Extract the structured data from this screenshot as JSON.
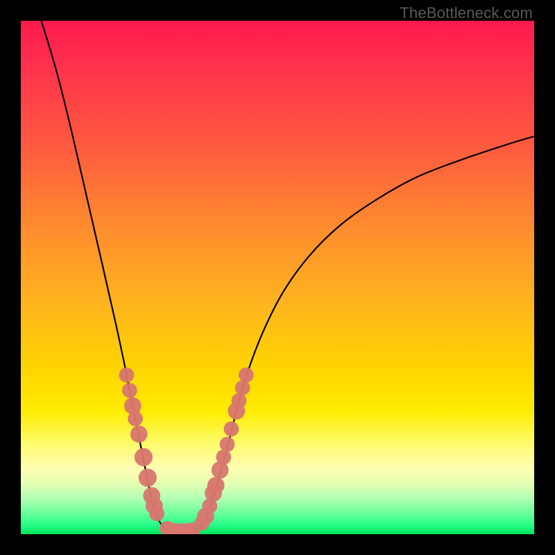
{
  "watermark_text": "TheBottleneck.com",
  "chart_data": {
    "type": "line",
    "title": "",
    "xlabel": "",
    "ylabel": "",
    "xlim": [
      0,
      100
    ],
    "ylim": [
      0,
      100
    ],
    "grid": false,
    "legend": false,
    "curve_left": [
      {
        "x": 4,
        "y": 100
      },
      {
        "x": 7,
        "y": 90
      },
      {
        "x": 10,
        "y": 78
      },
      {
        "x": 13,
        "y": 65
      },
      {
        "x": 16,
        "y": 52
      },
      {
        "x": 18.5,
        "y": 41
      },
      {
        "x": 20,
        "y": 34
      },
      {
        "x": 21,
        "y": 29
      },
      {
        "x": 22,
        "y": 24
      },
      {
        "x": 23,
        "y": 19
      },
      {
        "x": 24,
        "y": 14
      },
      {
        "x": 25,
        "y": 9
      },
      {
        "x": 26,
        "y": 5
      },
      {
        "x": 27,
        "y": 2.5
      },
      {
        "x": 28,
        "y": 1.3
      },
      {
        "x": 29,
        "y": 0.7
      }
    ],
    "curve_flat": [
      {
        "x": 29,
        "y": 0.7
      },
      {
        "x": 30,
        "y": 0.6
      },
      {
        "x": 31,
        "y": 0.6
      },
      {
        "x": 32,
        "y": 0.6
      },
      {
        "x": 33,
        "y": 0.7
      },
      {
        "x": 34,
        "y": 0.9
      }
    ],
    "curve_right": [
      {
        "x": 34,
        "y": 0.9
      },
      {
        "x": 35,
        "y": 1.5
      },
      {
        "x": 36,
        "y": 3
      },
      {
        "x": 37,
        "y": 5.5
      },
      {
        "x": 38,
        "y": 9
      },
      {
        "x": 40,
        "y": 16
      },
      {
        "x": 42,
        "y": 24
      },
      {
        "x": 44,
        "y": 31
      },
      {
        "x": 47,
        "y": 39
      },
      {
        "x": 51,
        "y": 47
      },
      {
        "x": 56,
        "y": 54
      },
      {
        "x": 62,
        "y": 60
      },
      {
        "x": 69,
        "y": 65
      },
      {
        "x": 77,
        "y": 69.5
      },
      {
        "x": 86,
        "y": 73
      },
      {
        "x": 95,
        "y": 76
      },
      {
        "x": 100,
        "y": 77.5
      }
    ],
    "markers_left": [
      {
        "x": 20.6,
        "y": 31,
        "r": 1.0
      },
      {
        "x": 21.2,
        "y": 28,
        "r": 1.0
      },
      {
        "x": 21.8,
        "y": 25,
        "r": 1.2
      },
      {
        "x": 22.3,
        "y": 22.5,
        "r": 1.0
      },
      {
        "x": 23.0,
        "y": 19.5,
        "r": 1.2
      },
      {
        "x": 23.9,
        "y": 15,
        "r": 1.3
      },
      {
        "x": 24.7,
        "y": 11,
        "r": 1.3
      },
      {
        "x": 25.5,
        "y": 7.5,
        "r": 1.2
      },
      {
        "x": 26.0,
        "y": 5.5,
        "r": 1.2
      },
      {
        "x": 26.5,
        "y": 4.0,
        "r": 1.0
      }
    ],
    "markers_bottom": [
      {
        "x": 28.5,
        "y": 1.1,
        "r": 1.0
      },
      {
        "x": 29.5,
        "y": 0.8,
        "r": 1.0
      },
      {
        "x": 30.5,
        "y": 0.65,
        "r": 1.0
      },
      {
        "x": 31.5,
        "y": 0.65,
        "r": 1.0
      },
      {
        "x": 32.5,
        "y": 0.7,
        "r": 1.0
      },
      {
        "x": 33.5,
        "y": 0.85,
        "r": 1.0
      }
    ],
    "markers_right": [
      {
        "x": 35.3,
        "y": 2.2,
        "r": 1.0
      },
      {
        "x": 36.0,
        "y": 3.5,
        "r": 1.2
      },
      {
        "x": 36.8,
        "y": 5.5,
        "r": 1.0
      },
      {
        "x": 37.5,
        "y": 8.0,
        "r": 1.2
      },
      {
        "x": 38.0,
        "y": 9.5,
        "r": 1.2
      },
      {
        "x": 38.8,
        "y": 12.5,
        "r": 1.2
      },
      {
        "x": 39.5,
        "y": 15,
        "r": 1.0
      },
      {
        "x": 40.2,
        "y": 17.5,
        "r": 1.0
      },
      {
        "x": 41.0,
        "y": 20.5,
        "r": 1.0
      },
      {
        "x": 42.0,
        "y": 24.0,
        "r": 1.2
      },
      {
        "x": 42.5,
        "y": 26.0,
        "r": 1.0
      },
      {
        "x": 43.2,
        "y": 28.5,
        "r": 1.0
      },
      {
        "x": 43.9,
        "y": 31.0,
        "r": 1.0
      }
    ]
  }
}
